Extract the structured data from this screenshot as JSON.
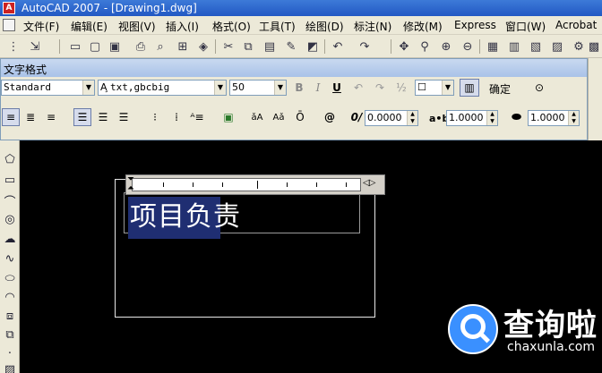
{
  "window": {
    "title": "AutoCAD 2007 - [Drawing1.dwg]"
  },
  "menu": [
    "文件(F)",
    "编辑(E)",
    "视图(V)",
    "插入(I)",
    "格式(O)",
    "工具(T)",
    "绘图(D)",
    "标注(N)",
    "修改(M)",
    "Express",
    "窗口(W)",
    "Acrobat"
  ],
  "text_format": {
    "caption": "文字格式",
    "style": "Standard",
    "font": "txt,gbcbig",
    "height": "50",
    "bold": "B",
    "italic": "I",
    "underline": "U",
    "ok_label": "确定",
    "oblique_value": "0.0000",
    "tracking_label": "a•b",
    "tracking_value": "1.0000",
    "width_value": "1.0000",
    "at_symbol": "@",
    "oblique_symbol": "0/",
    "case_upper": "ǎA",
    "case_lower": "Aǎ",
    "overline": "Ō"
  },
  "editor": {
    "text": "项目负责"
  },
  "watermark": {
    "name": "查询啦",
    "url": "chaxunla.com"
  },
  "colors": {
    "selection": "#1f2e72",
    "canvas": "#000000",
    "titlebar": "#2a62c9"
  }
}
